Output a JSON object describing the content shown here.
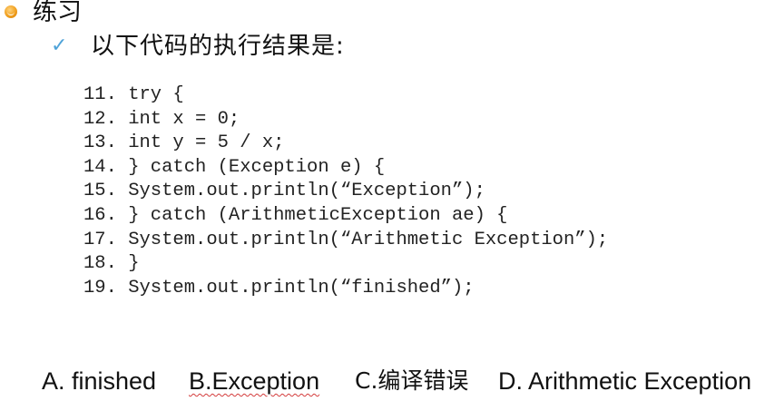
{
  "slide": {
    "title": "练习",
    "question": "以下代码的执行结果是:",
    "bullet_icon": "orange-round-bullet-icon",
    "check_icon": "checkmark-icon"
  },
  "code": {
    "lines": [
      "11. try {",
      "12. int x = 0;",
      "13. int y = 5 / x;",
      "14. } catch (Exception e) {",
      "15. System.out.println(“Exception”);",
      "16. } catch (ArithmeticException ae) {",
      "17. System.out.println(“Arithmetic Exception”);",
      "18. }",
      "19. System.out.println(“finished”);"
    ]
  },
  "options": {
    "a": "A.  finished",
    "b": "B.Exception",
    "c": "C.编译错误",
    "d": "D. Arithmetic Exception"
  },
  "colors": {
    "check": "#4fa3d8",
    "bullet": "#f0a020",
    "spell_underline": "#d43c3c"
  }
}
